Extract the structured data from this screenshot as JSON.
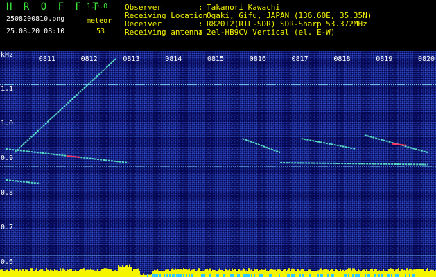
{
  "header": {
    "app_title": "H R O F F T",
    "app_version": "1.0.0",
    "filename": "2508200810.png",
    "meteor_label": "meteor",
    "datetime": "25.08.20 08:10",
    "meteor_count": "53",
    "info": [
      {
        "label": "Observer",
        "sep": ":",
        "value": "Takanori Kawachi"
      },
      {
        "label": "Receiving Location",
        "sep": ":",
        "value": "Ogaki, Gifu, JAPAN (136.60E, 35.35N)"
      },
      {
        "label": "Receiver",
        "sep": ":",
        "value": "R820T2(RTL-SDR) SDR-Sharp 53.372MHz"
      },
      {
        "label": "Receiving antenna",
        "sep": ":",
        "value": "2el-HB9CV Vertical (el. E-W)"
      }
    ]
  },
  "colors": {
    "background": "#000000",
    "plot_background": "#03034a",
    "header_green": "#39e639",
    "header_yellow": "#f2f200",
    "axis_text": "#ffffff",
    "carrier_line": "#7fd6ff",
    "echo_cyan": "#5ff0d0",
    "echo_red": "#ff3060",
    "noise_yellow": "#f5f500",
    "noise_cyan": "#2ec8ff"
  },
  "chart_data": {
    "type": "heatmap",
    "ylabel": "kHz",
    "y_ticks": [
      "1.1",
      "1.0",
      "0.9",
      "0.8",
      "0.7",
      "0.6"
    ],
    "x_ticks": [
      "0811",
      "0812",
      "0813",
      "0814",
      "0815",
      "0816",
      "0817",
      "0818",
      "0819",
      "0820"
    ],
    "carrier_lines_khz": [
      1.115,
      0.88
    ],
    "echoes": [
      {
        "t": [
          "0810.2",
          "0812.6"
        ],
        "f_khz": [
          0.92,
          1.19
        ],
        "style": "cyan"
      },
      {
        "t": [
          "0810.0",
          "0812.9"
        ],
        "f_khz": [
          0.93,
          0.89
        ],
        "style": "cyan-red"
      },
      {
        "t": [
          "0810.0",
          "0810.8"
        ],
        "f_khz": [
          0.84,
          0.83
        ],
        "style": "cyan"
      },
      {
        "t": [
          "0815.6",
          "0816.5"
        ],
        "f_khz": [
          0.96,
          0.92
        ],
        "style": "cyan"
      },
      {
        "t": [
          "0817.0",
          "0818.3"
        ],
        "f_khz": [
          0.96,
          0.93
        ],
        "style": "cyan"
      },
      {
        "t": [
          "0818.5",
          "0820.0"
        ],
        "f_khz": [
          0.97,
          0.92
        ],
        "style": "cyan-red"
      },
      {
        "t": [
          "0816.5",
          "0820.0"
        ],
        "f_khz": [
          0.89,
          0.885
        ],
        "style": "cyan"
      }
    ]
  }
}
